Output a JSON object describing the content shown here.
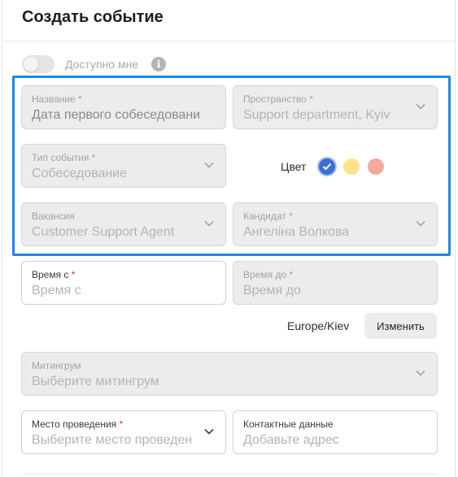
{
  "dialog": {
    "title": "Создать событие"
  },
  "availability": {
    "label": "Доступно мне",
    "on": false,
    "info_icon": "info-icon"
  },
  "fields": {
    "name": {
      "label": "Название",
      "required_mark": "*",
      "value": "Дата первого собеседовани"
    },
    "space": {
      "label": "Пространство",
      "required_mark": "*",
      "value": "Support department, Kyiv"
    },
    "event_type": {
      "label": "Тип события",
      "required_mark": "*",
      "value": "Собеседование"
    },
    "vacancy": {
      "label": "Вакансия",
      "value": "Customer Support Agent"
    },
    "candidate": {
      "label": "Кандидат",
      "required_mark": "*",
      "value": "Ангеліна Волкова"
    },
    "time_from": {
      "label": "Время с",
      "required_mark": "*",
      "placeholder": "Время с"
    },
    "time_to": {
      "label": "Время до",
      "required_mark": "*",
      "placeholder": "Время до"
    },
    "meeting_room": {
      "label": "Митингрум",
      "placeholder": "Выберите митингрум"
    },
    "venue": {
      "label": "Место проведения",
      "required_mark": "*",
      "placeholder": "Выберите место проведен"
    },
    "contact": {
      "label": "Контактные данные",
      "placeholder": "Добавьте адрес"
    }
  },
  "color": {
    "label": "Цвет",
    "options": [
      "#3b6fd6",
      "#fde28a",
      "#f2aa9d"
    ],
    "selected": "#3b6fd6"
  },
  "timezone": {
    "value": "Europe/Kiev",
    "change_label": "Изменить"
  },
  "colors": {
    "highlight": "#1e88e5",
    "required": "#e0312f"
  }
}
